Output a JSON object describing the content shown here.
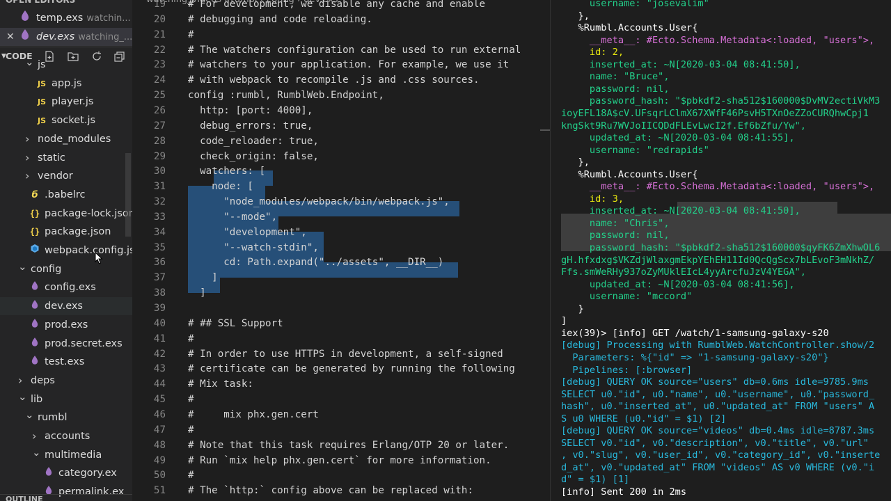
{
  "sidebar": {
    "open_editors_label": "OPEN EDITORS",
    "open_editors": [
      {
        "name": "temp.exs",
        "desc": "watchin..."
      },
      {
        "name": "dev.exs",
        "desc": "watching_..."
      }
    ],
    "section_label": "CODE",
    "tree": [
      {
        "name": "js",
        "type": "folder-open",
        "level": 1
      },
      {
        "name": "app.js",
        "type": "js",
        "level": 2
      },
      {
        "name": "player.js",
        "type": "js",
        "level": 2
      },
      {
        "name": "socket.js",
        "type": "js",
        "level": 2
      },
      {
        "name": "node_modules",
        "type": "folder",
        "level": 1
      },
      {
        "name": "static",
        "type": "folder",
        "level": 1
      },
      {
        "name": "vendor",
        "type": "folder",
        "level": 1
      },
      {
        "name": ".babelrc",
        "type": "babel",
        "level": 1
      },
      {
        "name": "package-lock.json",
        "type": "json",
        "level": 1
      },
      {
        "name": "package.json",
        "type": "json",
        "level": 1
      },
      {
        "name": "webpack.config.js",
        "type": "webpack",
        "level": 1
      },
      {
        "name": "config",
        "type": "folder-open",
        "level": 0
      },
      {
        "name": "config.exs",
        "type": "exs",
        "level": 1
      },
      {
        "name": "dev.exs",
        "type": "exs",
        "level": 1
      },
      {
        "name": "prod.exs",
        "type": "exs",
        "level": 1
      },
      {
        "name": "prod.secret.exs",
        "type": "exs",
        "level": 1
      },
      {
        "name": "test.exs",
        "type": "exs",
        "level": 1
      },
      {
        "name": "deps",
        "type": "folder",
        "level": 0
      },
      {
        "name": "lib",
        "type": "folder-open",
        "level": 0
      },
      {
        "name": "rumbl",
        "type": "folder-open",
        "level": 1
      },
      {
        "name": "accounts",
        "type": "folder",
        "level": 2
      },
      {
        "name": "multimedia",
        "type": "folder-open",
        "level": 2
      },
      {
        "name": "category.ex",
        "type": "exs",
        "level": 3
      },
      {
        "name": "permalink.ex",
        "type": "exs",
        "level": 3
      }
    ],
    "outline_label": "OUTLINE"
  },
  "editor": {
    "breadcrumb": "watching_videos › rumbl › config › dev.exs",
    "lines": [
      {
        "n": "19",
        "t": "# For development, we disable any cache and enable"
      },
      {
        "n": "20",
        "t": "# debugging and code reloading."
      },
      {
        "n": "21",
        "t": "#"
      },
      {
        "n": "22",
        "t": "# The watchers configuration can be used to run external"
      },
      {
        "n": "23",
        "t": "# watchers to your application. For example, we use it"
      },
      {
        "n": "24",
        "t": "# with webpack to recompile .js and .css sources."
      },
      {
        "n": "25",
        "t": "config :rumbl, RumblWeb.Endpoint,"
      },
      {
        "n": "26",
        "t": "  http: [port: 4000],"
      },
      {
        "n": "27",
        "t": "  debug_errors: true,"
      },
      {
        "n": "28",
        "t": "  code_reloader: true,"
      },
      {
        "n": "29",
        "t": "  check_origin: false,"
      },
      {
        "n": "30",
        "t": "  watchers: ["
      },
      {
        "n": "31",
        "t": "    node: ["
      },
      {
        "n": "32",
        "t": "      \"node_modules/webpack/bin/webpack.js\","
      },
      {
        "n": "33",
        "t": "      \"--mode\","
      },
      {
        "n": "34",
        "t": "      \"development\","
      },
      {
        "n": "35",
        "t": "      \"--watch-stdin\","
      },
      {
        "n": "36",
        "t": "      cd: Path.expand(\"../assets\", __DIR__)"
      },
      {
        "n": "37",
        "t": "    ]"
      },
      {
        "n": "38",
        "t": "  ]"
      },
      {
        "n": "39",
        "t": ""
      },
      {
        "n": "40",
        "t": "# ## SSL Support"
      },
      {
        "n": "41",
        "t": "#"
      },
      {
        "n": "42",
        "t": "# In order to use HTTPS in development, a self-signed"
      },
      {
        "n": "43",
        "t": "# certificate can be generated by running the following"
      },
      {
        "n": "44",
        "t": "# Mix task:"
      },
      {
        "n": "45",
        "t": "#"
      },
      {
        "n": "46",
        "t": "#     mix phx.gen.cert"
      },
      {
        "n": "47",
        "t": "#"
      },
      {
        "n": "48",
        "t": "# Note that this task requires Erlang/OTP 20 or later."
      },
      {
        "n": "49",
        "t": "# Run `mix help phx.gen.cert` for more information."
      },
      {
        "n": "50",
        "t": "#"
      },
      {
        "n": "51",
        "t": "# The `http:` config above can be replaced with:"
      }
    ]
  },
  "terminal": {
    "lines": [
      {
        "t": "     username: \"josevalim\"",
        "c": "t-green"
      },
      {
        "t": "   },",
        "c": "t-white"
      },
      {
        "t": "   %Rumbl.Accounts.User{",
        "c": "t-white"
      },
      {
        "t": "     __meta__: #Ecto.Schema.Metadata<:loaded, \"users\">,",
        "c": "mixed-meta"
      },
      {
        "t": "     id: 2,",
        "c": "mixed-id"
      },
      {
        "t": "     inserted_at: ~N[2020-03-04 08:41:50],",
        "c": "t-green"
      },
      {
        "t": "     name: \"Bruce\",",
        "c": "t-green"
      },
      {
        "t": "     password: nil,",
        "c": "mixed-nil"
      },
      {
        "t": "     password_hash: \"$pbkdf2-sha512$160000$DvMV2ectiVkM3",
        "c": "t-green"
      },
      {
        "t": "ioyEFL18A$cV.UFsqrLClmX67XWfF46PsvH5TXnOeZZoCURQhwCpj1",
        "c": "t-green"
      },
      {
        "t": "kngSkt9Ru7WVJoIICQDdFLEvLwcI2f.Ef6bZfu/Yw\",",
        "c": "t-green"
      },
      {
        "t": "     updated_at: ~N[2020-03-04 08:41:55],",
        "c": "t-green"
      },
      {
        "t": "     username: \"redrapids\"",
        "c": "t-green"
      },
      {
        "t": "   },",
        "c": "t-white"
      },
      {
        "t": "   %Rumbl.Accounts.User{",
        "c": "t-white"
      },
      {
        "t": "     __meta__: #Ecto.Schema.Metadata<:loaded, \"users\">,",
        "c": "mixed-meta"
      },
      {
        "t": "     id: 3,",
        "c": "mixed-id"
      },
      {
        "t": "     inserted_at: ~N[2020-03-04 08:41:50],",
        "c": "t-green"
      },
      {
        "t": "     name: \"Chris\",",
        "c": "t-green"
      },
      {
        "t": "     password: nil,",
        "c": "mixed-nil"
      },
      {
        "t": "     password_hash: \"$pbkdf2-sha512$160000$qyFK6ZmXhwOL6",
        "c": "t-green"
      },
      {
        "t": "gH.hfxdxg$VKZdjWlaxgmEkpYEhEH11Id0QcQgScx7bLEvoF3mNkhZ/",
        "c": "t-green"
      },
      {
        "t": "Ffs.smWeRHy937oZyMUklEIcL4yyArcfuJzV4YEGA\",",
        "c": "t-green"
      },
      {
        "t": "     updated_at: ~N[2020-03-04 08:41:56],",
        "c": "t-green"
      },
      {
        "t": "     username: \"mccord\"",
        "c": "t-green"
      },
      {
        "t": "   }",
        "c": "t-white"
      },
      {
        "t": "]",
        "c": "t-white"
      },
      {
        "t": "iex(39)> [info] GET /watch/1-samsung-galaxy-s20",
        "c": "t-white"
      },
      {
        "t": "[debug] Processing with RumblWeb.WatchController.show/2",
        "c": "t-cyan"
      },
      {
        "t": "  Parameters: %{\"id\" => \"1-samsung-galaxy-s20\"}",
        "c": "t-cyan"
      },
      {
        "t": "  Pipelines: [:browser]",
        "c": "t-cyan"
      },
      {
        "t": "[debug] QUERY OK source=\"users\" db=0.6ms idle=9785.9ms",
        "c": "t-cyan"
      },
      {
        "t": "SELECT u0.\"id\", u0.\"name\", u0.\"username\", u0.\"password_",
        "c": "t-cyan"
      },
      {
        "t": "hash\", u0.\"inserted_at\", u0.\"updated_at\" FROM \"users\" A",
        "c": "t-cyan"
      },
      {
        "t": "S u0 WHERE (u0.\"id\" = $1) [2]",
        "c": "t-cyan"
      },
      {
        "t": "[debug] QUERY OK source=\"videos\" db=0.4ms idle=8787.3ms",
        "c": "t-cyan"
      },
      {
        "t": "SELECT v0.\"id\", v0.\"description\", v0.\"title\", v0.\"url\"",
        "c": "t-cyan"
      },
      {
        "t": ", v0.\"slug\", v0.\"user_id\", v0.\"category_id\", v0.\"inserte",
        "c": "t-cyan"
      },
      {
        "t": "d_at\", v0.\"updated_at\" FROM \"videos\" AS v0 WHERE (v0.\"i",
        "c": "t-cyan"
      },
      {
        "t": "d\" = $1) [1]",
        "c": "t-cyan"
      },
      {
        "t": "[info] Sent 200 in 2ms",
        "c": "t-white"
      },
      {
        "t": "_",
        "c": "t-white"
      }
    ]
  },
  "colors": {
    "sidebar_bg": "#252526",
    "editor_bg": "#1e1e1e",
    "selection": "#264f78",
    "comment": "#6a9955",
    "string": "#ce9178",
    "keyword": "#569cd6",
    "term_green": "#23d18b",
    "term_cyan": "#29b8db"
  }
}
